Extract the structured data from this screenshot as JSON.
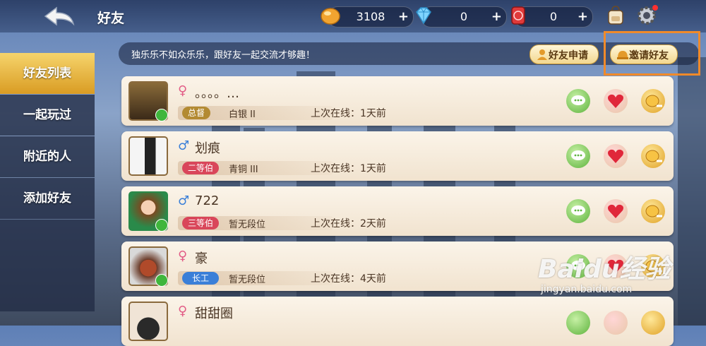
{
  "header": {
    "title": "好友",
    "coins": "3108",
    "diamonds": "0",
    "tickets": "0",
    "plus": "+"
  },
  "sidebar": {
    "items": [
      {
        "label": "好友列表"
      },
      {
        "label": "一起玩过"
      },
      {
        "label": "附近的人"
      },
      {
        "label": "添加好友"
      }
    ]
  },
  "banner": {
    "text": "独乐乐不如众乐乐，跟好友一起交流才够趣！",
    "friend_request": "好友申请",
    "invite": "邀请好友"
  },
  "friends": [
    {
      "gender": "♀",
      "name": "。。。。…",
      "title": "总督",
      "tier": "白银 II",
      "online": "上次在线：1天前"
    },
    {
      "gender": "♂",
      "name": "划痕",
      "title": "二等伯",
      "tier": "青铜 III",
      "online": "上次在线：1天前"
    },
    {
      "gender": "♂",
      "name": "722",
      "title": "三等伯",
      "tier": "暂无段位",
      "online": "上次在线：2天前"
    },
    {
      "gender": "♀",
      "name": "豪",
      "title": "长工",
      "tier": "暂无段位",
      "online": "上次在线：4天前"
    },
    {
      "gender": "♀",
      "name": "甜甜圈",
      "title": "",
      "tier": "",
      "online": ""
    }
  ],
  "watermark": {
    "main": "Baidu经验",
    "sub": "jingyan.baidu.com"
  },
  "colors": {
    "accent_gold": "#d99c23",
    "female": "#e25c86",
    "male": "#3a7fd8",
    "highlight": "#f08a2a"
  }
}
